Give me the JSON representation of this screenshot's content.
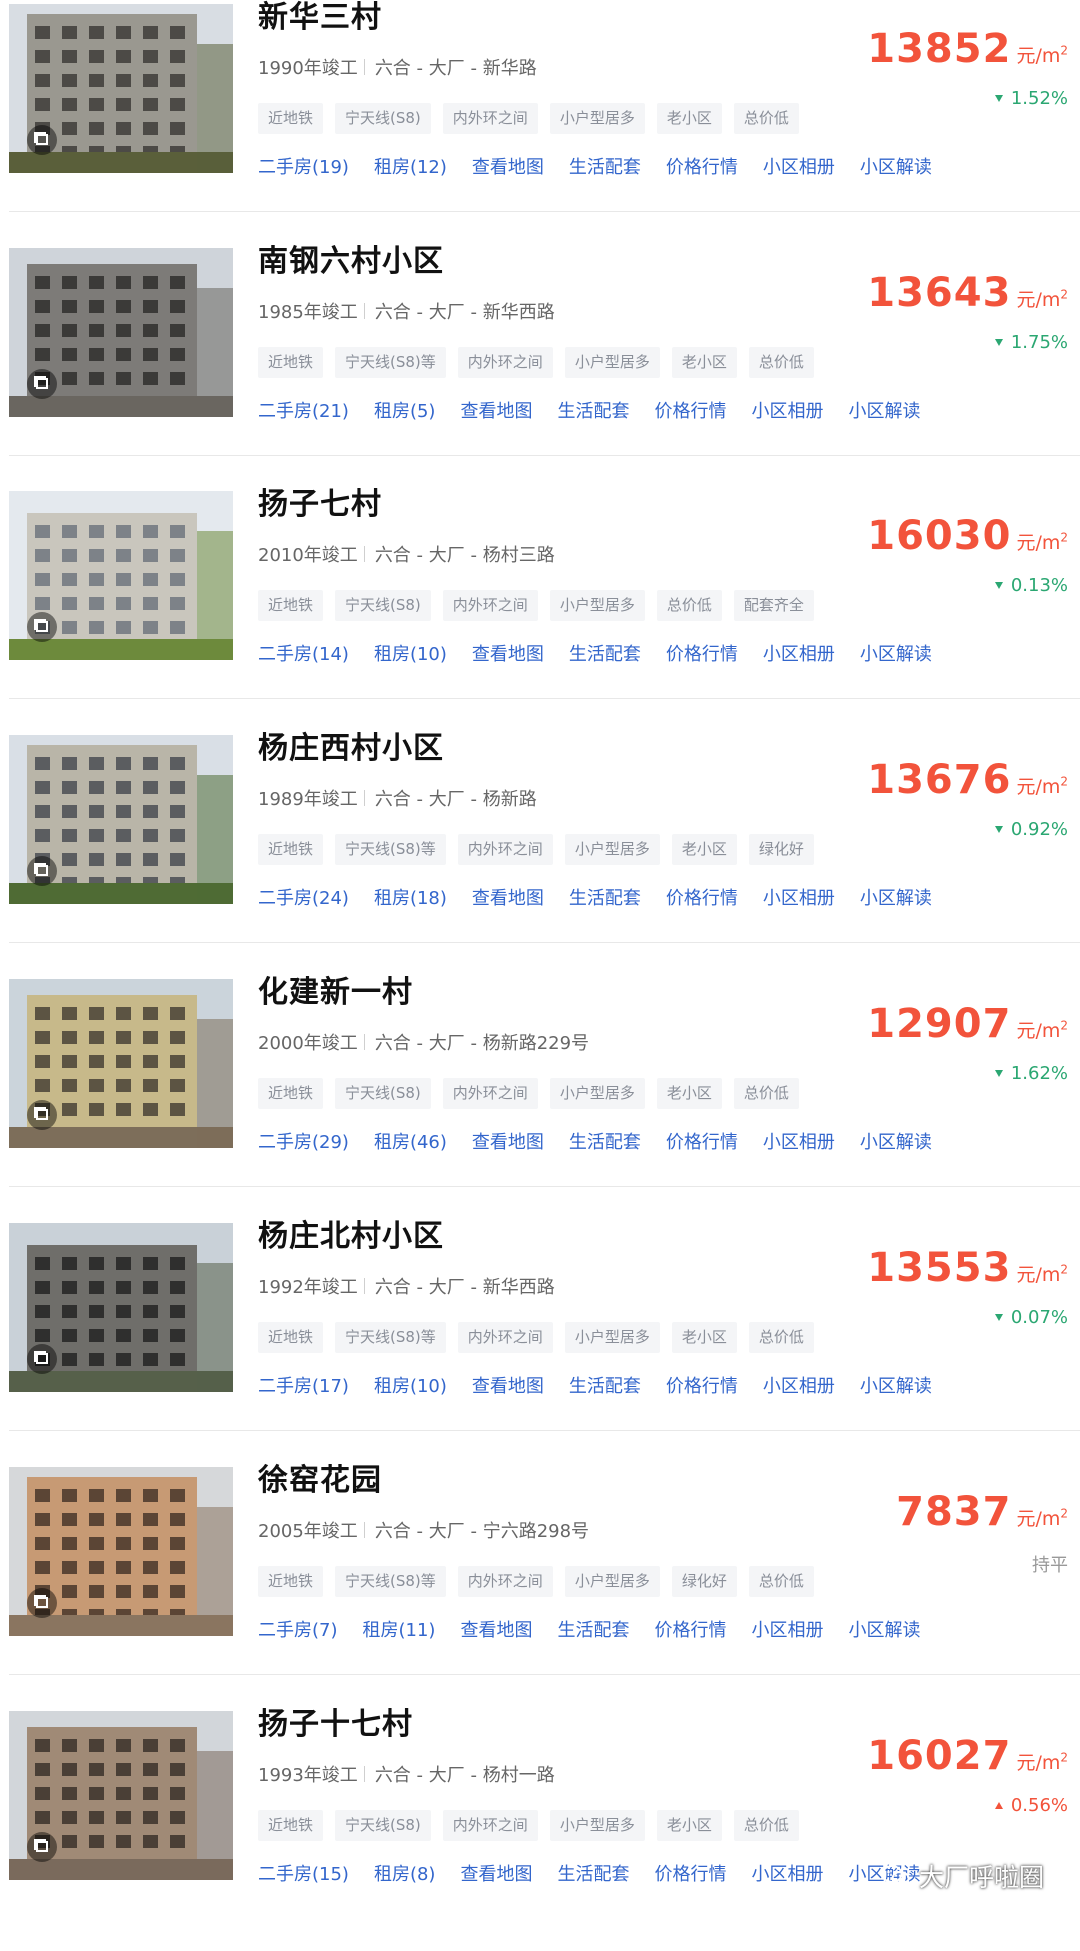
{
  "communities": [
    {
      "name": "新华三村",
      "year": "1990年竣工",
      "location": "六合 - 大厂 - 新华路",
      "tags": [
        "近地铁",
        "宁天线(S8)",
        "内外环之间",
        "小户型居多",
        "老小区",
        "总价低"
      ],
      "links": [
        "二手房(19)",
        "租房(12)",
        "查看地图",
        "生活配套",
        "价格行情",
        "小区相册",
        "小区解读"
      ],
      "price": "13852",
      "unit": "元/m",
      "unit_sup": "2",
      "change": "1.52%",
      "change_dir": "down"
    },
    {
      "name": "南钢六村小区",
      "year": "1985年竣工",
      "location": "六合 - 大厂 - 新华西路",
      "tags": [
        "近地铁",
        "宁天线(S8)等",
        "内外环之间",
        "小户型居多",
        "老小区",
        "总价低"
      ],
      "links": [
        "二手房(21)",
        "租房(5)",
        "查看地图",
        "生活配套",
        "价格行情",
        "小区相册",
        "小区解读"
      ],
      "price": "13643",
      "unit": "元/m",
      "unit_sup": "2",
      "change": "1.75%",
      "change_dir": "down"
    },
    {
      "name": "扬子七村",
      "year": "2010年竣工",
      "location": "六合 - 大厂 - 杨村三路",
      "tags": [
        "近地铁",
        "宁天线(S8)",
        "内外环之间",
        "小户型居多",
        "总价低",
        "配套齐全"
      ],
      "links": [
        "二手房(14)",
        "租房(10)",
        "查看地图",
        "生活配套",
        "价格行情",
        "小区相册",
        "小区解读"
      ],
      "price": "16030",
      "unit": "元/m",
      "unit_sup": "2",
      "change": "0.13%",
      "change_dir": "down"
    },
    {
      "name": "杨庄西村小区",
      "year": "1989年竣工",
      "location": "六合 - 大厂 - 杨新路",
      "tags": [
        "近地铁",
        "宁天线(S8)等",
        "内外环之间",
        "小户型居多",
        "老小区",
        "绿化好"
      ],
      "links": [
        "二手房(24)",
        "租房(18)",
        "查看地图",
        "生活配套",
        "价格行情",
        "小区相册",
        "小区解读"
      ],
      "price": "13676",
      "unit": "元/m",
      "unit_sup": "2",
      "change": "0.92%",
      "change_dir": "down"
    },
    {
      "name": "化建新一村",
      "year": "2000年竣工",
      "location": "六合 - 大厂 - 杨新路229号",
      "tags": [
        "近地铁",
        "宁天线(S8)",
        "内外环之间",
        "小户型居多",
        "老小区",
        "总价低"
      ],
      "links": [
        "二手房(29)",
        "租房(46)",
        "查看地图",
        "生活配套",
        "价格行情",
        "小区相册",
        "小区解读"
      ],
      "price": "12907",
      "unit": "元/m",
      "unit_sup": "2",
      "change": "1.62%",
      "change_dir": "down"
    },
    {
      "name": "杨庄北村小区",
      "year": "1992年竣工",
      "location": "六合 - 大厂 - 新华西路",
      "tags": [
        "近地铁",
        "宁天线(S8)等",
        "内外环之间",
        "小户型居多",
        "老小区",
        "总价低"
      ],
      "links": [
        "二手房(17)",
        "租房(10)",
        "查看地图",
        "生活配套",
        "价格行情",
        "小区相册",
        "小区解读"
      ],
      "price": "13553",
      "unit": "元/m",
      "unit_sup": "2",
      "change": "0.07%",
      "change_dir": "down"
    },
    {
      "name": "徐窑花园",
      "year": "2005年竣工",
      "location": "六合 - 大厂 - 宁六路298号",
      "tags": [
        "近地铁",
        "宁天线(S8)等",
        "内外环之间",
        "小户型居多",
        "绿化好",
        "总价低"
      ],
      "links": [
        "二手房(7)",
        "租房(11)",
        "查看地图",
        "生活配套",
        "价格行情",
        "小区相册",
        "小区解读"
      ],
      "price": "7837",
      "unit": "元/m",
      "unit_sup": "2",
      "change": "持平",
      "change_dir": "flat"
    },
    {
      "name": "扬子十七村",
      "year": "1993年竣工",
      "location": "六合 - 大厂 - 杨村一路",
      "tags": [
        "近地铁",
        "宁天线(S8)",
        "内外环之间",
        "小户型居多",
        "老小区",
        "总价低"
      ],
      "links": [
        "二手房(15)",
        "租房(8)",
        "查看地图",
        "生活配套",
        "价格行情",
        "小区相册",
        "小区解读"
      ],
      "price": "16027",
      "unit": "元/m",
      "unit_sup": "2",
      "change": "0.56%",
      "change_dir": "up"
    }
  ],
  "watermark": {
    "text": "大厂呼啦圈",
    "icon": "wechat-icon"
  },
  "colors": {
    "price": "#f2533b",
    "down": "#2ba772",
    "link": "#3366cc",
    "tag_bg": "#f4f5f7"
  }
}
